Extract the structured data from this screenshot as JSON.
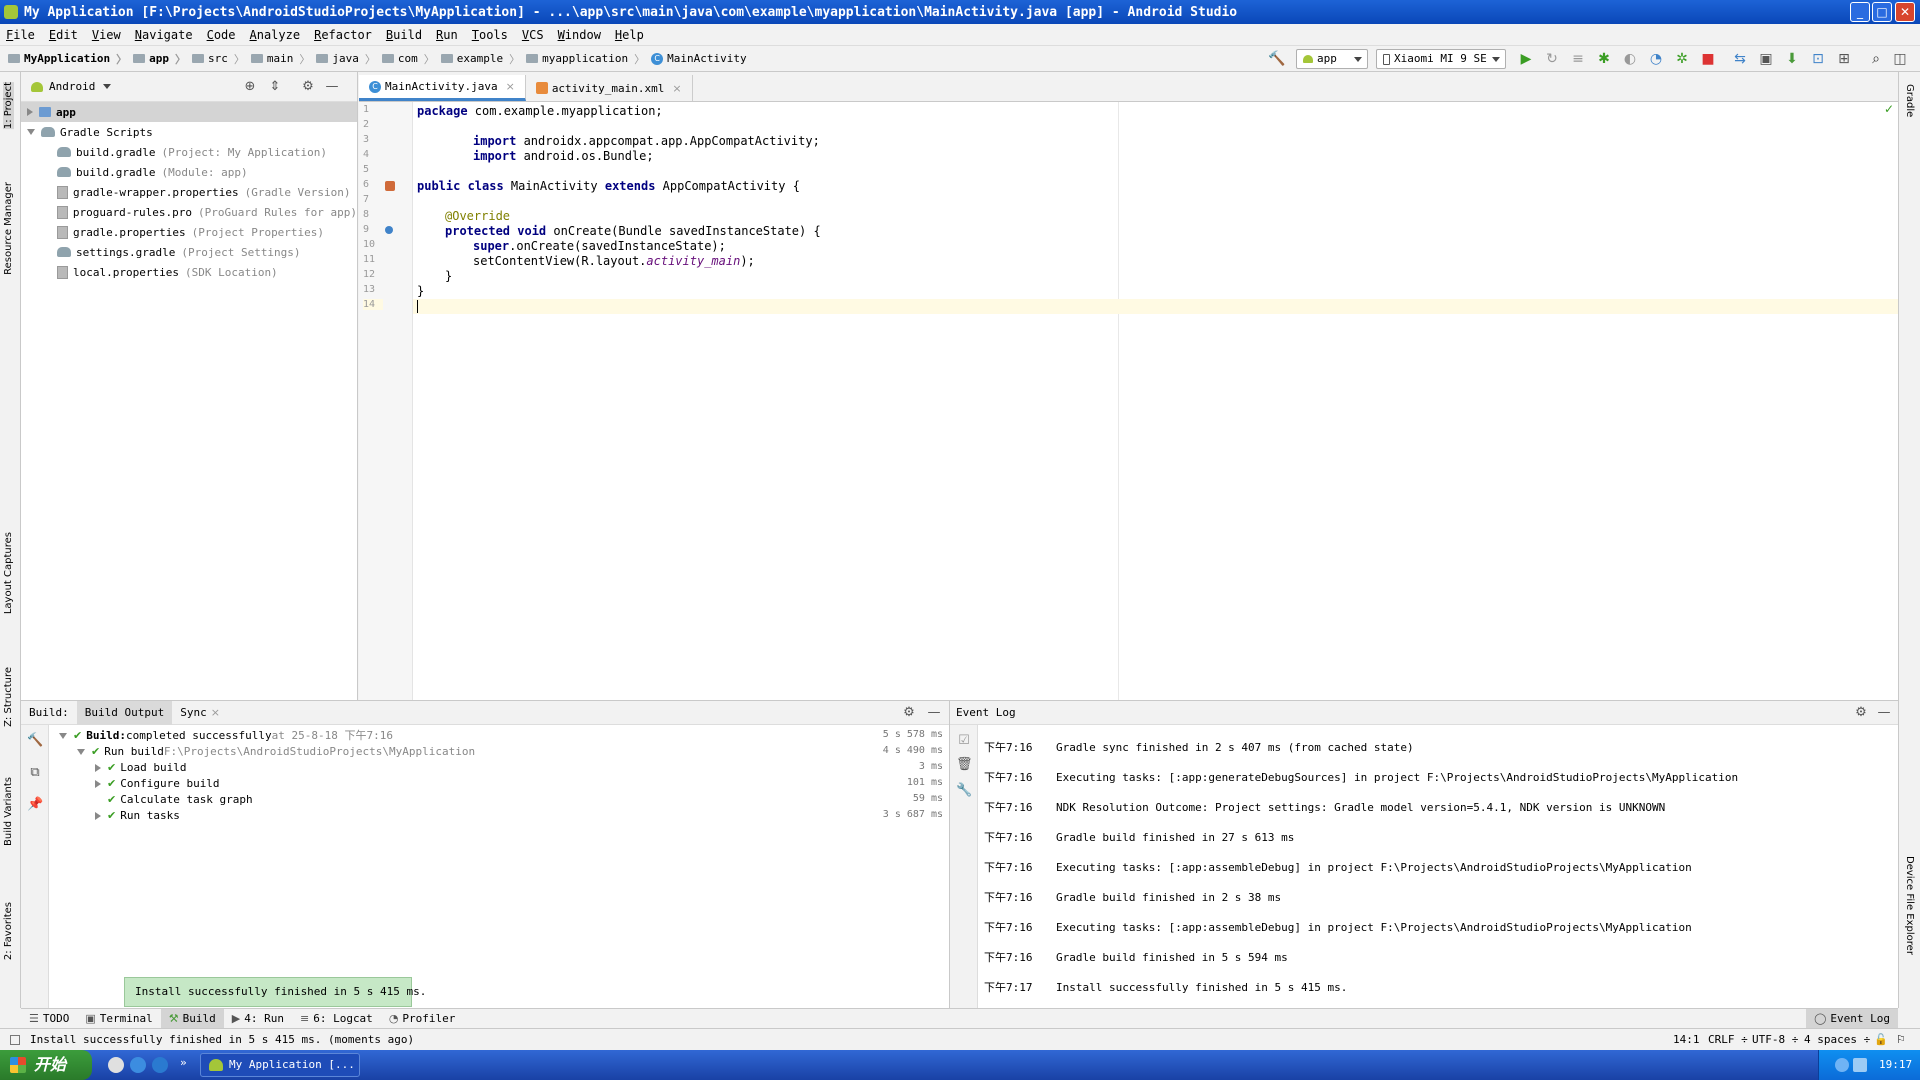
{
  "window": {
    "title": "My Application [F:\\Projects\\AndroidStudioProjects\\MyApplication] - ...\\app\\src\\main\\java\\com\\example\\myapplication\\MainActivity.java [app] - Android Studio",
    "minimize": "_",
    "maximize": "□",
    "close": "✕"
  },
  "menu": [
    "File",
    "Edit",
    "View",
    "Navigate",
    "Code",
    "Analyze",
    "Refactor",
    "Build",
    "Run",
    "Tools",
    "VCS",
    "Window",
    "Help"
  ],
  "breadcrumbs": [
    "MyApplication",
    "app",
    "src",
    "main",
    "java",
    "com",
    "example",
    "myapplication",
    "MainActivity"
  ],
  "toolbar": {
    "run_config": "app",
    "device": "Xiaomi MI 9 SE"
  },
  "project": {
    "view_mode": "Android",
    "tree": [
      {
        "label": "app",
        "hint": ""
      },
      {
        "label": "Gradle Scripts",
        "hint": ""
      },
      {
        "label": "build.gradle",
        "hint": "(Project: My Application)"
      },
      {
        "label": "build.gradle",
        "hint": "(Module: app)"
      },
      {
        "label": "gradle-wrapper.properties",
        "hint": "(Gradle Version)"
      },
      {
        "label": "proguard-rules.pro",
        "hint": "(ProGuard Rules for app)"
      },
      {
        "label": "gradle.properties",
        "hint": "(Project Properties)"
      },
      {
        "label": "settings.gradle",
        "hint": "(Project Settings)"
      },
      {
        "label": "local.properties",
        "hint": "(SDK Location)"
      }
    ]
  },
  "left_tabs": [
    "1: Project",
    "Resource Manager",
    "Layout Captures",
    "Z: Structure",
    "Build Variants",
    "2: Favorites"
  ],
  "right_tabs": [
    "Gradle",
    "Device File Explorer"
  ],
  "editor": {
    "tabs": [
      {
        "label": "MainActivity.java",
        "close": "×"
      },
      {
        "label": "activity_main.xml",
        "close": "×"
      }
    ],
    "line_numbers": [
      "1",
      "2",
      "3",
      "4",
      "5",
      "6",
      "7",
      "8",
      "9",
      "10",
      "11",
      "12",
      "13",
      "14"
    ],
    "lines": {
      "l1_kw": "package",
      "l1_rest": " com.example.myapplication;",
      "l3_kw": "import",
      "l3_rest": " androidx.appcompat.app.AppCompatActivity;",
      "l4_kw": "import",
      "l4_rest": " android.os.Bundle;",
      "l6_kw": "public class",
      "l6_name": " MainActivity ",
      "l6_kw2": "extends",
      "l6_rest": " AppCompatActivity {",
      "l8_ann": "@Override",
      "l9_kw": "protected void",
      "l9_rest": " onCreate(Bundle savedInstanceState) {",
      "l10_kw": "super",
      "l10_rest": ".onCreate(savedInstanceState);",
      "l11_pre": "setContentView(R.layout.",
      "l11_it": "activity_main",
      "l11_post": ");",
      "l12": "}",
      "l13": "}"
    }
  },
  "build": {
    "label": "Build:",
    "tabs": [
      {
        "label": "Build Output",
        "close": ""
      },
      {
        "label": "Sync",
        "close": "×"
      }
    ],
    "rows": [
      {
        "bold": "Build:",
        "text": " completed successfully",
        "hint": " at 25-8-18 下午7:16",
        "time": "5 s 578 ms"
      },
      {
        "bold": "",
        "text": "Run build",
        "hint": " F:\\Projects\\AndroidStudioProjects\\MyApplication",
        "time": "4 s 490 ms"
      },
      {
        "bold": "",
        "text": "Load build",
        "hint": "",
        "time": "3 ms"
      },
      {
        "bold": "",
        "text": "Configure build",
        "hint": "",
        "time": "101 ms"
      },
      {
        "bold": "",
        "text": "Calculate task graph",
        "hint": "",
        "time": "59 ms"
      },
      {
        "bold": "",
        "text": "Run tasks",
        "hint": "",
        "time": "3 s 687 ms"
      }
    ]
  },
  "event_log": {
    "title": "Event Log",
    "entries": [
      {
        "time": "下午7:16",
        "msg": "Gradle sync finished in 2 s 407 ms (from cached state)"
      },
      {
        "time": "下午7:16",
        "msg": "Executing tasks: [:app:generateDebugSources] in project F:\\Projects\\AndroidStudioProjects\\MyApplication"
      },
      {
        "time": "下午7:16",
        "msg": "NDK Resolution Outcome: Project settings: Gradle model version=5.4.1, NDK version is UNKNOWN"
      },
      {
        "time": "下午7:16",
        "msg": "Gradle build finished in 27 s 613 ms"
      },
      {
        "time": "下午7:16",
        "msg": "Executing tasks: [:app:assembleDebug] in project F:\\Projects\\AndroidStudioProjects\\MyApplication"
      },
      {
        "time": "下午7:16",
        "msg": "Gradle build finished in 2 s 38 ms"
      },
      {
        "time": "下午7:16",
        "msg": "Executing tasks: [:app:assembleDebug] in project F:\\Projects\\AndroidStudioProjects\\MyApplication"
      },
      {
        "time": "下午7:16",
        "msg": "Gradle build finished in 5 s 594 ms"
      },
      {
        "time": "下午7:17",
        "msg": "Install successfully finished in 5 s 415 ms."
      }
    ]
  },
  "balloon": "Install successfully finished in 5 s 415 ms.",
  "bottom_tabs": [
    "TODO",
    "Terminal",
    "Build",
    "4: Run",
    "6: Logcat",
    "Profiler"
  ],
  "event_log_button": "Event Log",
  "status": {
    "message": "Install successfully finished in 5 s 415 ms. (moments ago)",
    "position": "14:1",
    "line_sep": "CRLF ÷",
    "encoding": "UTF-8 ÷",
    "indent": "4 spaces ÷"
  },
  "taskbar": {
    "start": "开始",
    "task": "My Application [...",
    "clock": "19:17"
  },
  "colors": {
    "accent": "#4083c9",
    "success": "#3a9d23",
    "title_bar": "#0a47b8"
  }
}
